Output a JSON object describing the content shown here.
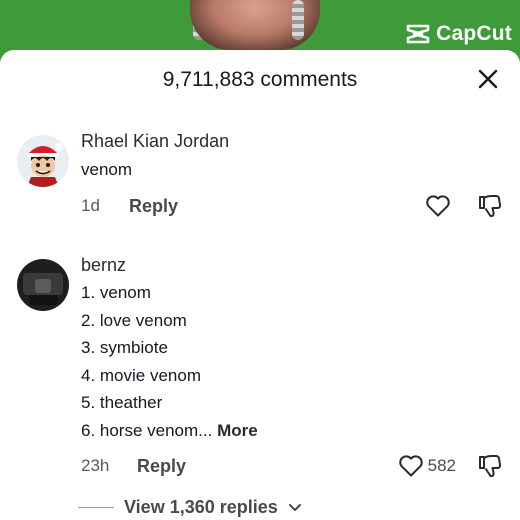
{
  "watermark": {
    "label": "CapCut",
    "icon": "capcut-logo-icon"
  },
  "sheet": {
    "title": "9,711,883 comments",
    "close_icon": "close-icon"
  },
  "comments": [
    {
      "user": "Rhael Kian Jordan",
      "lines": [
        "venom"
      ],
      "time": "1d",
      "reply_label": "Reply",
      "likes": "",
      "avatar": "cartoon-pirate-avatar"
    },
    {
      "user": "bernz",
      "lines": [
        "1. venom",
        "2. love venom",
        "3. symbiote",
        "4. movie venom",
        "5. theather",
        "6. horse venom..."
      ],
      "more_label": "More",
      "time": "23h",
      "reply_label": "Reply",
      "likes": "582",
      "avatar": "dark-photo-avatar"
    }
  ],
  "view_replies": {
    "label": "View 1,360 replies",
    "icon": "chevron-down-icon"
  },
  "colors": {
    "video_bg": "#3f9a3a",
    "text": "#161823",
    "muted": "#4a4a4a"
  }
}
